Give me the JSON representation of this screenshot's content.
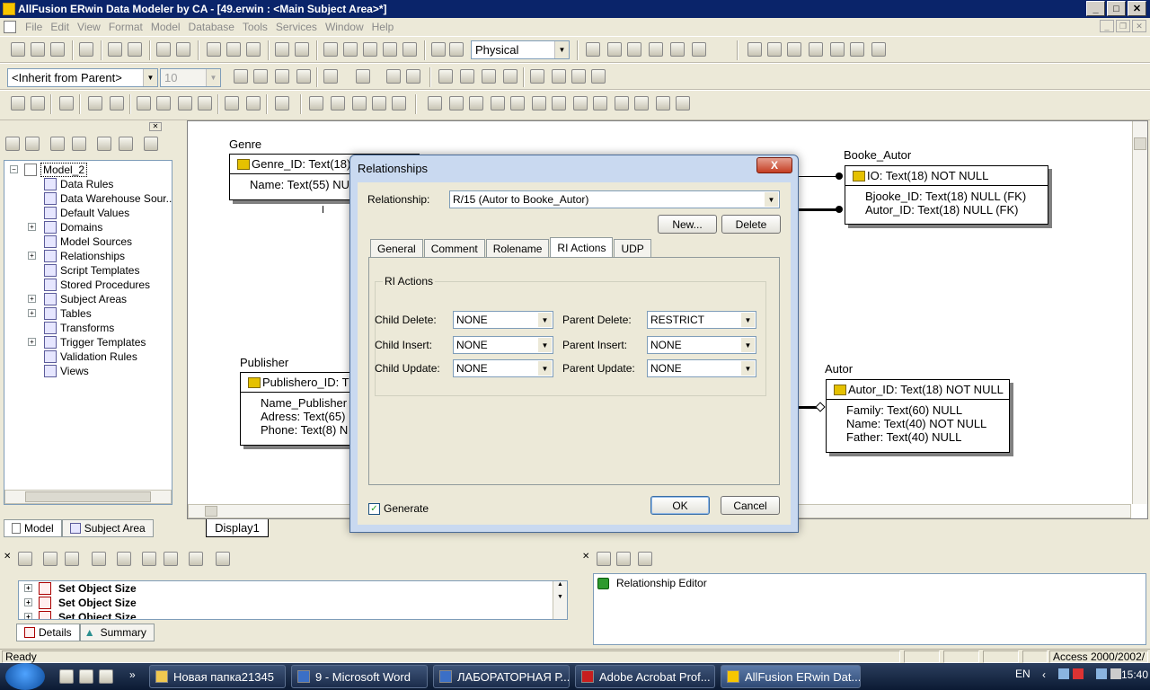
{
  "window": {
    "title": "AllFusion ERwin Data Modeler by CA - [49.erwin : <Main Subject Area>*]"
  },
  "menu": [
    "File",
    "Edit",
    "View",
    "Format",
    "Model",
    "Database",
    "Tools",
    "Services",
    "Window",
    "Help"
  ],
  "toolbar": {
    "view_mode": "Physical",
    "font_style": "<Inherit from Parent>",
    "font_size": "10"
  },
  "tree": {
    "root": "Model_2",
    "items": [
      {
        "label": "Data Rules",
        "expandable": false
      },
      {
        "label": "Data Warehouse Sour...",
        "expandable": false
      },
      {
        "label": "Default Values",
        "expandable": false
      },
      {
        "label": "Domains",
        "expandable": true
      },
      {
        "label": "Model Sources",
        "expandable": false
      },
      {
        "label": "Relationships",
        "expandable": true
      },
      {
        "label": "Script Templates",
        "expandable": false
      },
      {
        "label": "Stored Procedures",
        "expandable": false
      },
      {
        "label": "Subject Areas",
        "expandable": true
      },
      {
        "label": "Tables",
        "expandable": true
      },
      {
        "label": "Transforms",
        "expandable": false
      },
      {
        "label": "Trigger Templates",
        "expandable": true
      },
      {
        "label": "Validation Rules",
        "expandable": false
      },
      {
        "label": "Views",
        "expandable": false
      }
    ]
  },
  "left_tabs": [
    "Model",
    "Subject Area"
  ],
  "diagram": {
    "tab_label": "Display1",
    "entities": {
      "genre": {
        "name": "Genre",
        "pk": "Genre_ID: Text(18)",
        "attrs": [
          "Name: Text(55) NUL"
        ]
      },
      "publisher": {
        "name": "Publisher",
        "pk": "Publishero_ID: T",
        "attrs": [
          "Name_Publisher",
          "Adress: Text(65)",
          "Phone: Text(8) N"
        ]
      },
      "booke_autor": {
        "name": "Booke_Autor",
        "pk": "IO: Text(18) NOT NULL",
        "attrs": [
          "Bjooke_ID: Text(18) NULL (FK)",
          "Autor_ID: Text(18) NULL (FK)"
        ]
      },
      "autor": {
        "name": "Autor",
        "pk": "Autor_ID: Text(18) NOT NULL",
        "attrs": [
          "Family: Text(60) NULL",
          "Name: Text(40) NOT NULL",
          "Father: Text(40) NULL"
        ]
      }
    }
  },
  "dialog": {
    "title": "Relationships",
    "close_label": "X",
    "relationship_label": "Relationship:",
    "relationship_value": "R/15 (Autor to Booke_Autor)",
    "new_label": "New...",
    "delete_label": "Delete",
    "tabs": [
      "General",
      "Comment",
      "Rolename",
      "RI Actions",
      "UDP"
    ],
    "active_tab": "RI Actions",
    "group_label": "RI Actions",
    "ri": {
      "child_delete_label": "Child Delete:",
      "child_delete": "NONE",
      "child_insert_label": "Child Insert:",
      "child_insert": "NONE",
      "child_update_label": "Child Update:",
      "child_update": "NONE",
      "parent_delete_label": "Parent Delete:",
      "parent_delete": "RESTRICT",
      "parent_insert_label": "Parent Insert:",
      "parent_insert": "NONE",
      "parent_update_label": "Parent Update:",
      "parent_update": "NONE"
    },
    "generate_label": "Generate",
    "generate_checked": true,
    "ok_label": "OK",
    "cancel_label": "Cancel"
  },
  "bottom_left": {
    "rows": [
      "Set Object Size",
      "Set Object Size",
      "Set Object Size"
    ],
    "tabs": [
      "Details",
      "Summary"
    ]
  },
  "bottom_right": {
    "item": "Relationship Editor"
  },
  "status": {
    "left": "Ready",
    "right": "Access 2000/2002/"
  },
  "taskbar": {
    "tasks": [
      "Новая папка21345",
      "9 - Microsoft Word",
      "ЛАБОРАТОРНАЯ Р...",
      "Adobe Acrobat Prof...",
      "AllFusion ERwin Dat..."
    ],
    "lang": "EN",
    "clock": "15:40"
  }
}
